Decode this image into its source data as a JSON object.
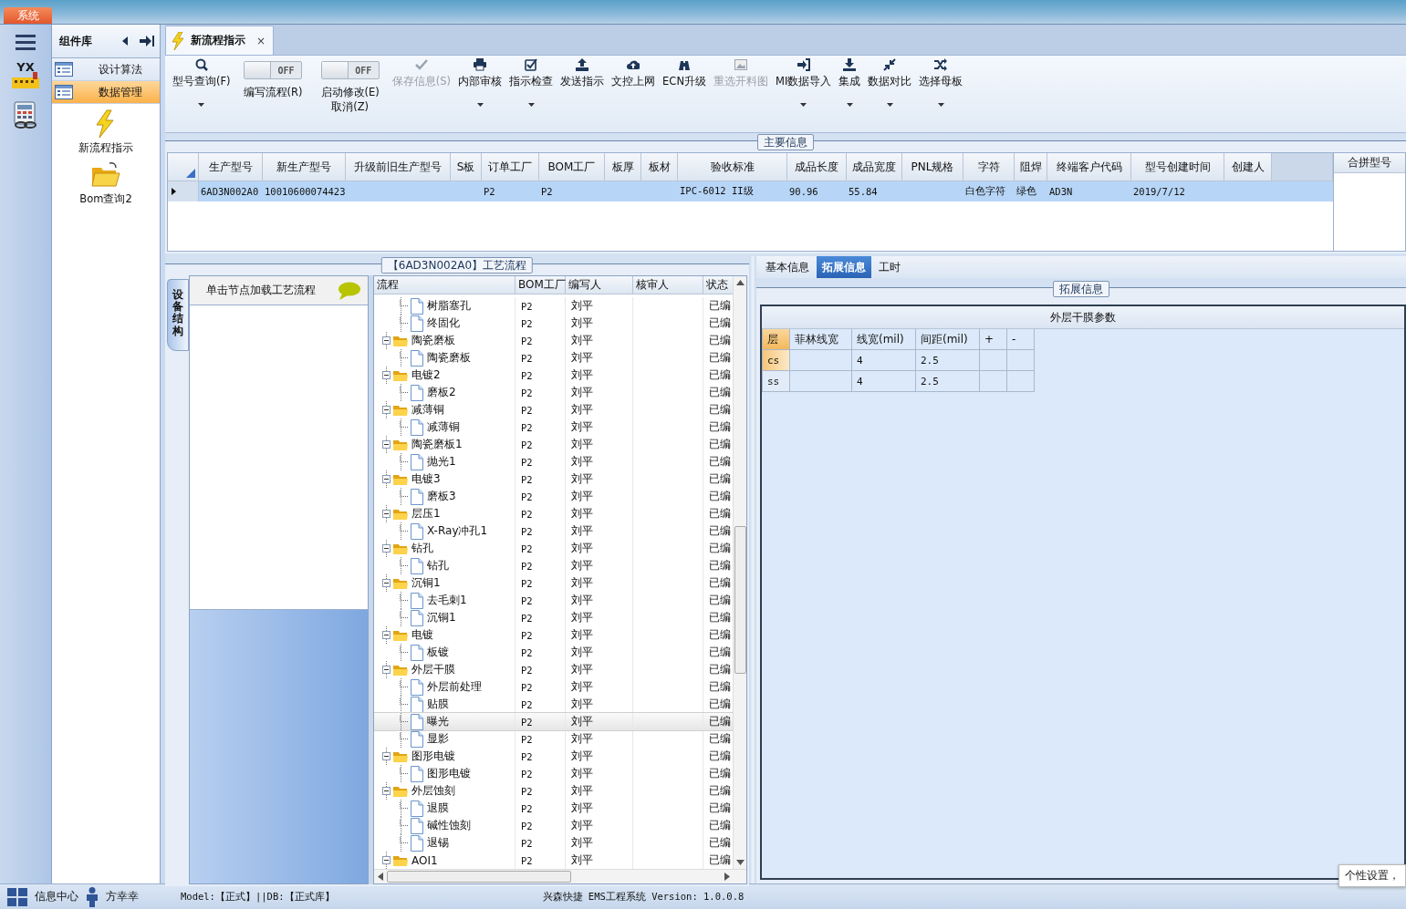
{
  "system_tab": {
    "label": "系统",
    "selected": true
  },
  "left_rail": {
    "logo_text": "YX"
  },
  "component_panel": {
    "title": "组件库",
    "items": [
      {
        "label": "设计算法",
        "selected": false
      },
      {
        "label": "数据管理",
        "selected": true
      }
    ],
    "tools": [
      {
        "label": "新流程指示"
      },
      {
        "label": "Bom查询2"
      }
    ]
  },
  "document_tabs": [
    {
      "label": "新流程指示",
      "close": "×",
      "selected": true
    }
  ],
  "toolbar": [
    {
      "kind": "button",
      "label": "型号查询(F)",
      "disabled": false,
      "dropdown": true
    },
    {
      "kind": "toggle",
      "label": "编写流程(R)",
      "switch_text": "OFF",
      "on": false
    },
    {
      "kind": "toggle",
      "label": "启动修改(E)\n取消(Z)",
      "switch_text": "OFF",
      "on": false
    },
    {
      "kind": "button",
      "label": "保存信息(S)",
      "disabled": true,
      "dropdown": false
    },
    {
      "kind": "button",
      "label": "内部审核",
      "disabled": false,
      "dropdown": true
    },
    {
      "kind": "button",
      "label": "指示检查",
      "disabled": false,
      "dropdown": true
    },
    {
      "kind": "button",
      "label": "发送指示",
      "disabled": false,
      "dropdown": false
    },
    {
      "kind": "button",
      "label": "文控上网",
      "disabled": false,
      "dropdown": false
    },
    {
      "kind": "button",
      "label": "ECN升级",
      "disabled": false,
      "dropdown": false
    },
    {
      "kind": "button",
      "label": "重选开料图",
      "disabled": true,
      "dropdown": false
    },
    {
      "kind": "button",
      "label": "MI数据导入",
      "disabled": false,
      "dropdown": true
    },
    {
      "kind": "button",
      "label": "集成",
      "disabled": false,
      "dropdown": true
    },
    {
      "kind": "button",
      "label": "数据对比",
      "disabled": false,
      "dropdown": true
    },
    {
      "kind": "button",
      "label": "选择母板",
      "disabled": false,
      "dropdown": true
    }
  ],
  "main_info": {
    "title": "主要信息",
    "columns": [
      "生产型号",
      "新生产型号",
      "升级前旧生产型号",
      "S板",
      "订单工厂",
      "BOM工厂",
      "板厚",
      "板材",
      "验收标准",
      "成品长度",
      "成品宽度",
      "PNL规格",
      "字符",
      "阻焊",
      "终端客户代码",
      "型号创建时间",
      "创建人"
    ],
    "rows": [
      {
        "selected": true,
        "cells": [
          "6AD3N002A0",
          "10010600074423",
          "",
          "",
          "P2",
          "P2",
          "",
          "",
          "IPC-6012 II级",
          "90.96",
          "55.84",
          "",
          "白色字符",
          "绿色",
          "AD3N",
          "2019/7/12",
          ""
        ]
      }
    ],
    "side_column": "合拼型号"
  },
  "process": {
    "title": "【6AD3N002A0】工艺流程",
    "side_tab": {
      "label": "设备结构",
      "selected": true
    },
    "hint": "单击节点加载工艺流程",
    "columns": [
      "流程",
      "BOM工厂",
      "编写人",
      "核审人",
      "状态"
    ],
    "tree": [
      {
        "children": [
          {
            "name": "树脂塞孔",
            "kind": "file",
            "selected": false,
            "cells": [
              "P2",
              "刘平",
              "",
              "已编"
            ]
          },
          {
            "name": "终固化",
            "kind": "file",
            "selected": false,
            "cells": [
              "P2",
              "刘平",
              "",
              "已编"
            ]
          }
        ]
      },
      {
        "name": "陶瓷磨板",
        "kind": "folder",
        "expanded": true,
        "selected": false,
        "cells": [
          "P2",
          "刘平",
          "",
          "已编"
        ],
        "children": [
          {
            "name": "陶瓷磨板",
            "kind": "file",
            "selected": false,
            "cells": [
              "P2",
              "刘平",
              "",
              "已编"
            ]
          }
        ]
      },
      {
        "name": "电镀2",
        "kind": "folder",
        "expanded": true,
        "selected": false,
        "cells": [
          "P2",
          "刘平",
          "",
          "已编"
        ],
        "children": [
          {
            "name": "磨板2",
            "kind": "file",
            "selected": false,
            "cells": [
              "P2",
              "刘平",
              "",
              "已编"
            ]
          }
        ]
      },
      {
        "name": "减薄铜",
        "kind": "folder",
        "expanded": true,
        "selected": false,
        "cells": [
          "P2",
          "刘平",
          "",
          "已编"
        ],
        "children": [
          {
            "name": "减薄铜",
            "kind": "file",
            "selected": false,
            "cells": [
              "P2",
              "刘平",
              "",
              "已编"
            ]
          }
        ]
      },
      {
        "name": "陶瓷磨板1",
        "kind": "folder",
        "expanded": true,
        "selected": false,
        "cells": [
          "P2",
          "刘平",
          "",
          "已编"
        ],
        "children": [
          {
            "name": "抛光1",
            "kind": "file",
            "selected": false,
            "cells": [
              "P2",
              "刘平",
              "",
              "已编"
            ]
          }
        ]
      },
      {
        "name": "电镀3",
        "kind": "folder",
        "expanded": true,
        "selected": false,
        "cells": [
          "P2",
          "刘平",
          "",
          "已编"
        ],
        "children": [
          {
            "name": "磨板3",
            "kind": "file",
            "selected": false,
            "cells": [
              "P2",
              "刘平",
              "",
              "已编"
            ]
          }
        ]
      },
      {
        "name": "层压1",
        "kind": "folder",
        "expanded": true,
        "selected": false,
        "cells": [
          "P2",
          "刘平",
          "",
          "已编"
        ],
        "children": [
          {
            "name": "X-Ray冲孔1",
            "kind": "file",
            "selected": false,
            "cells": [
              "P2",
              "刘平",
              "",
              "已编"
            ]
          }
        ]
      },
      {
        "name": "钻孔",
        "kind": "folder",
        "expanded": true,
        "selected": false,
        "cells": [
          "P2",
          "刘平",
          "",
          "已编"
        ],
        "children": [
          {
            "name": "钻孔",
            "kind": "file",
            "selected": false,
            "cells": [
              "P2",
              "刘平",
              "",
              "已编"
            ]
          }
        ]
      },
      {
        "name": "沉铜1",
        "kind": "folder",
        "expanded": true,
        "selected": false,
        "cells": [
          "P2",
          "刘平",
          "",
          "已编"
        ],
        "children": [
          {
            "name": "去毛刺1",
            "kind": "file",
            "selected": false,
            "cells": [
              "P2",
              "刘平",
              "",
              "已编"
            ]
          },
          {
            "name": "沉铜1",
            "kind": "file",
            "selected": false,
            "cells": [
              "P2",
              "刘平",
              "",
              "已编"
            ]
          }
        ]
      },
      {
        "name": "电镀",
        "kind": "folder",
        "expanded": true,
        "selected": false,
        "cells": [
          "P2",
          "刘平",
          "",
          "已编"
        ],
        "children": [
          {
            "name": "板镀",
            "kind": "file",
            "selected": false,
            "cells": [
              "P2",
              "刘平",
              "",
              "已编"
            ]
          }
        ]
      },
      {
        "name": "外层干膜",
        "kind": "folder",
        "expanded": true,
        "selected": false,
        "cells": [
          "P2",
          "刘平",
          "",
          "已编"
        ],
        "children": [
          {
            "name": "外层前处理",
            "kind": "file",
            "selected": false,
            "cells": [
              "P2",
              "刘平",
              "",
              "已编"
            ]
          },
          {
            "name": "贴膜",
            "kind": "file",
            "selected": false,
            "cells": [
              "P2",
              "刘平",
              "",
              "已编"
            ]
          },
          {
            "name": "曝光",
            "kind": "file",
            "selected": true,
            "cells": [
              "P2",
              "刘平",
              "",
              "已编"
            ]
          },
          {
            "name": "显影",
            "kind": "file",
            "selected": false,
            "cells": [
              "P2",
              "刘平",
              "",
              "已编"
            ]
          }
        ]
      },
      {
        "name": "图形电镀",
        "kind": "folder",
        "expanded": true,
        "selected": false,
        "cells": [
          "P2",
          "刘平",
          "",
          "已编"
        ],
        "children": [
          {
            "name": "图形电镀",
            "kind": "file",
            "selected": false,
            "cells": [
              "P2",
              "刘平",
              "",
              "已编"
            ]
          }
        ]
      },
      {
        "name": "外层蚀刻",
        "kind": "folder",
        "expanded": true,
        "selected": false,
        "cells": [
          "P2",
          "刘平",
          "",
          "已编"
        ],
        "children": [
          {
            "name": "退膜",
            "kind": "file",
            "selected": false,
            "cells": [
              "P2",
              "刘平",
              "",
              "已编"
            ]
          },
          {
            "name": "碱性蚀刻",
            "kind": "file",
            "selected": false,
            "cells": [
              "P2",
              "刘平",
              "",
              "已编"
            ]
          },
          {
            "name": "退锡",
            "kind": "file",
            "selected": false,
            "cells": [
              "P2",
              "刘平",
              "",
              "已编"
            ]
          }
        ]
      },
      {
        "name": "AOI1",
        "kind": "folder",
        "expanded": true,
        "selected": false,
        "cells": [
          "P2",
          "刘平",
          "",
          "已编"
        ]
      }
    ]
  },
  "detail": {
    "tabs": [
      {
        "label": "基本信息",
        "selected": false
      },
      {
        "label": "拓展信息",
        "selected": true
      },
      {
        "label": "工时",
        "selected": false
      }
    ],
    "group_title": "拓展信息",
    "grid": {
      "title": "外层干膜参数",
      "columns": [
        "层",
        "菲林线宽",
        "线宽(mil)",
        "间距(mil)",
        "+",
        "-"
      ],
      "rows": [
        {
          "selected": true,
          "cells": [
            "cs",
            "",
            "4",
            "2.5",
            "",
            ""
          ]
        },
        {
          "selected": false,
          "cells": [
            "ss",
            "",
            "4",
            "2.5",
            "",
            ""
          ]
        }
      ]
    }
  },
  "status_bar": {
    "info_center": "信息中心",
    "user": "方幸幸",
    "model": "Model:【正式】||DB:【正式库】",
    "version": "兴森快捷 EMS工程系统 Version: 1.0.0.8"
  },
  "tooltip": "个性设置，"
}
